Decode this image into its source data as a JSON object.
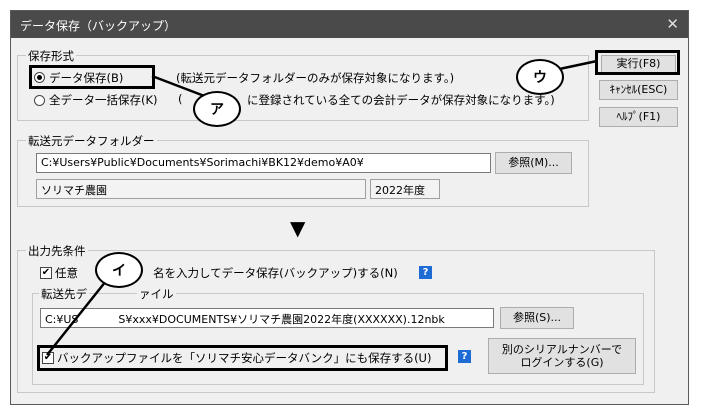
{
  "window": {
    "title": "データ保存（バックアップ）",
    "close_glyph": "✕"
  },
  "save_format": {
    "legend": "保存形式",
    "option1_label": "データ保存(B)",
    "option1_desc": "(転送元データフォルダーのみが保存対象になります。)",
    "option2_label": "全データ一括保存(K)",
    "option2_desc_a": "(",
    "option2_desc_b": "に登録されている全ての会計データが保存対象になります。)",
    "selected": "option1"
  },
  "buttons": {
    "execute": "実行(F8)",
    "cancel": "ｷｬﾝｾﾙ(ESC)",
    "help": "ﾍﾙﾌﾟ(F1)"
  },
  "source_folder": {
    "legend": "転送元データフォルダー",
    "path": "C:¥Users¥Public¥Documents¥Sorimachi¥BK12¥demo¥A0¥",
    "browse": "参照(M)...",
    "company": "ソリマチ農園",
    "year": "2022年度"
  },
  "destination": {
    "legend": "出力先条件",
    "check1_label_a": "任意",
    "check1_label_b": "名を入力してデータ保存(バックアップ)する(N)",
    "check1_checked": true,
    "inner_legend_a": "転送先デ",
    "inner_legend_b": "ァイル",
    "file_a": "C:¥US",
    "file_b": "S¥xxx¥DOCUMENTS¥ソリマチ農園2022年度(XXXXXX).12nbk",
    "browse": "参照(S)...",
    "check2_label": "バックアップファイルを「ソリマチ安心データバンク」にも保存する(U)",
    "check2_checked": true,
    "login_button": "別のシリアルナンバーで\nログインする(G)"
  },
  "callouts": {
    "a": "ア",
    "u": "ウ",
    "i": "イ"
  },
  "icons": {
    "help": "?",
    "check": "✔",
    "down_arrow": "▼"
  }
}
